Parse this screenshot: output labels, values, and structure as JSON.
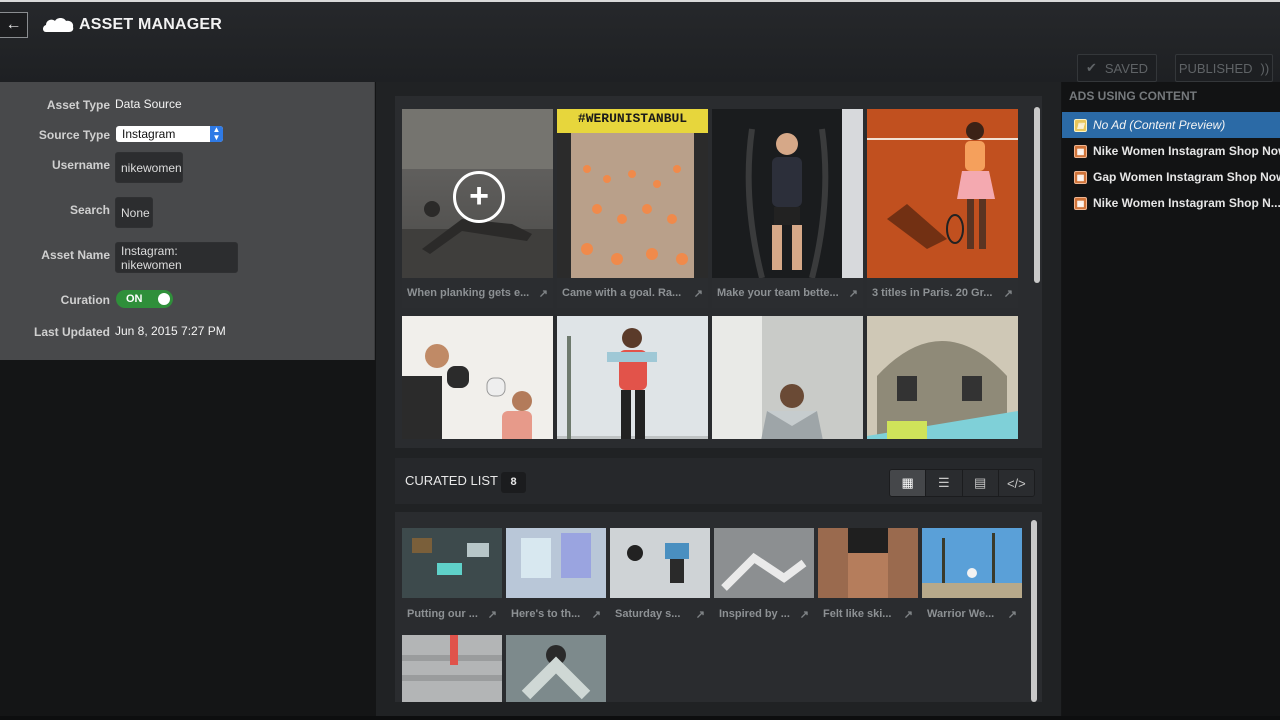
{
  "header": {
    "back_icon": "arrow-left-icon",
    "logo_icon": "cloud-icon",
    "title": "ASSET MANAGER",
    "saved_label": "SAVED",
    "published_label": "PUBLISHED"
  },
  "asset": {
    "asset_type_label": "Asset Type",
    "asset_type_value": "Data Source",
    "source_type_label": "Source Type",
    "source_type_value": "Instagram",
    "username_label": "Username",
    "username_value": "nikewomen",
    "search_label": "Search",
    "search_value": "None",
    "asset_name_label": "Asset Name",
    "asset_name_value": "Instagram: nikewomen",
    "curation_label": "Curation",
    "curation_value": "ON",
    "last_updated_label": "Last Updated",
    "last_updated_value": "Jun 8, 2015 7:27 PM"
  },
  "grid": {
    "items": [
      {
        "caption": "When planking gets e...",
        "icon": "add-circle-icon"
      },
      {
        "caption": "Came with a goal. Ra...",
        "banner": "#WERUNISTANBUL"
      },
      {
        "caption": "Make your team bette..."
      },
      {
        "caption": "3 titles in Paris. 20 Gr..."
      },
      {
        "caption": ""
      },
      {
        "caption": ""
      },
      {
        "caption": ""
      },
      {
        "caption": ""
      }
    ]
  },
  "curated": {
    "title": "CURATED LIST",
    "count": "8",
    "view_icons": [
      "grid-view-icon",
      "list-view-icon",
      "card-view-icon",
      "code-view-icon"
    ],
    "items": [
      {
        "caption": "Putting our ..."
      },
      {
        "caption": "Here's to th..."
      },
      {
        "caption": "Saturday s..."
      },
      {
        "caption": "Inspired by ..."
      },
      {
        "caption": "Felt like ski..."
      },
      {
        "caption": "Warrior We..."
      },
      {
        "caption": ""
      },
      {
        "caption": ""
      }
    ]
  },
  "ads": {
    "heading": "ADS USING CONTENT",
    "items": [
      {
        "label": "No Ad (Content Preview)",
        "selected": true
      },
      {
        "label": "Nike Women Instagram Shop Now"
      },
      {
        "label": "Gap Women Instagram Shop Now"
      },
      {
        "label": "Nike Women Instagram Shop N..."
      }
    ]
  },
  "colors": {
    "accent_blue": "#2b6aa6",
    "toggle_green": "#2f8f3a",
    "tennis_court": "#c1501f"
  }
}
